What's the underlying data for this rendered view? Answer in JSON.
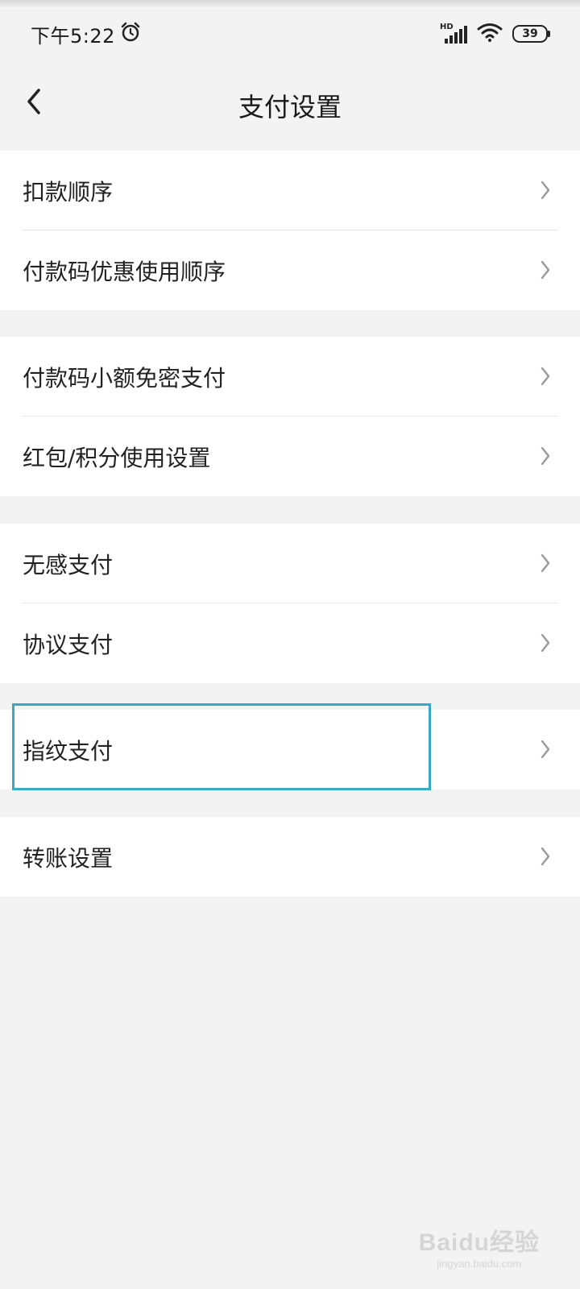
{
  "status_bar": {
    "time": "下午5:22",
    "network": "HD",
    "battery": "39"
  },
  "header": {
    "title": "支付设置"
  },
  "groups": [
    {
      "items": [
        {
          "label": "扣款顺序"
        },
        {
          "label": "付款码优惠使用顺序"
        }
      ]
    },
    {
      "items": [
        {
          "label": "付款码小额免密支付"
        },
        {
          "label": "红包/积分使用设置"
        }
      ]
    },
    {
      "items": [
        {
          "label": "无感支付"
        },
        {
          "label": "协议支付"
        }
      ]
    },
    {
      "items": [
        {
          "label": "指纹支付"
        }
      ]
    },
    {
      "items": [
        {
          "label": "转账设置"
        }
      ]
    }
  ],
  "watermark": {
    "logo": "Baidu经验",
    "url": "jingyan.baidu.com"
  },
  "colors": {
    "background": "#f3f3f3",
    "card": "#ffffff",
    "highlight_border": "#3aa7c4"
  }
}
